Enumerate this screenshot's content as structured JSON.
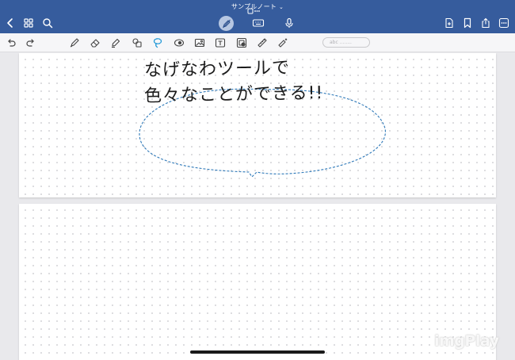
{
  "topbar": {
    "title": "サンプルノート",
    "title_chevron": "chevron-down-icon",
    "left_icons": [
      "back-chevron-icon",
      "grid-icon",
      "search-icon"
    ],
    "center_icons": [
      "pen-mode-icon",
      "keyboard-icon",
      "microphone-icon"
    ],
    "right_icons": [
      "add-page-icon",
      "bookmark-icon",
      "share-icon",
      "more-icon"
    ]
  },
  "toolbar": {
    "tools": [
      "undo-icon",
      "redo-icon",
      "pen-icon",
      "eraser-icon",
      "highlighter-icon",
      "shapes-icon",
      "lasso-icon",
      "laser-icon",
      "image-icon",
      "text-icon",
      "sticker-icon",
      "ruler-icon",
      "magic-icon"
    ],
    "active_tool": "lasso-icon",
    "autoshape_label": "abc ........"
  },
  "note": {
    "line1": "なげなわツールで",
    "line2": "色々なことができる!!"
  },
  "watermark": "imgPlay",
  "colors": {
    "topbar": "#365c9d",
    "accent": "#1f97d6",
    "bubble_outline": "#2d78b8"
  }
}
